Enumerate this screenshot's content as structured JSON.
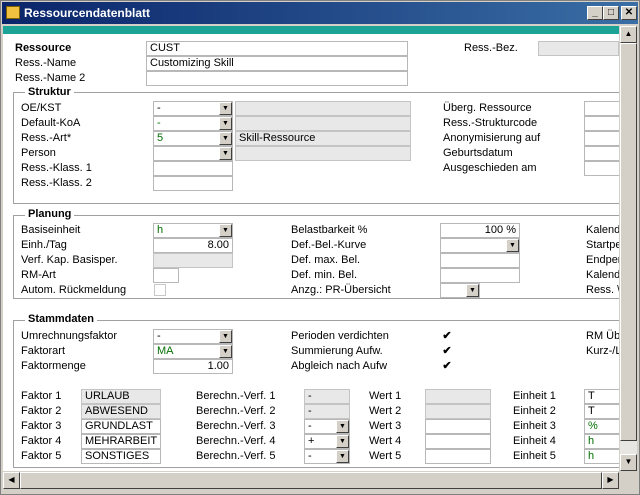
{
  "window": {
    "title": "Ressourcendatenblatt",
    "min_btn": "_",
    "max_btn": "□",
    "close_btn": "✕"
  },
  "header": {
    "ressource_label": "Ressource",
    "ressource_value": "CUST",
    "name_label": "Ress.-Name",
    "name_value": "Customizing Skill",
    "name2_label": "Ress.-Name 2",
    "name2_value": "",
    "bez_label": "Ress.-Bez.",
    "bez_value": ""
  },
  "struktur": {
    "title": "Struktur",
    "oekst_label": "OE/KST",
    "oekst_value": "-",
    "oekst_desc": "",
    "koa_label": "Default-KoA",
    "koa_value": "-",
    "koa_desc": "",
    "art_label": "Ress.-Art*",
    "art_value": "5",
    "art_desc": "Skill-Ressource",
    "person_label": "Person",
    "person_value": "",
    "person_desc": "",
    "klass1_label": "Ress.-Klass. 1",
    "klass1_value": "",
    "klass2_label": "Ress.-Klass. 2",
    "klass2_value": "",
    "uebg_label": "Überg. Ressource",
    "strukturcode_label": "Ress.-Strukturcode",
    "anonym_label": "Anonymisierung auf",
    "geburt_label": "Geburtsdatum",
    "ausgeschieden_label": "Ausgeschieden am"
  },
  "planung": {
    "title": "Planung",
    "basis_label": "Basiseinheit",
    "basis_value": "h",
    "einh_label": "Einh./Tag",
    "einh_value": "8.00",
    "verf_label": "Verf. Kap. Basisper.",
    "verf_value": "",
    "rmart_label": "RM-Art",
    "rmart_value": "",
    "autom_label": "Autom. Rückmeldung",
    "belast_label": "Belastbarkeit %",
    "belast_value": "100 %",
    "defbel_label": "Def.-Bel.-Kurve",
    "defbel_value": "",
    "defmax_label": "Def. max. Bel.",
    "defmax_value": "",
    "defmin_label": "Def. min. Bel.",
    "defmin_value": "",
    "anzg_label": "Anzg.: PR-Übersicht",
    "anzg_value": "",
    "kalend1_label": "Kalend",
    "startpe_label": "Startpe",
    "endper_label": "Endper",
    "kalend2_label": "Kalend",
    "ress_cut_label": "Ress. \\"
  },
  "stammdaten": {
    "title": "Stammdaten",
    "umr_label": "Umrechnungsfaktor",
    "umr_value": "-",
    "faktorart_label": "Faktorart",
    "faktorart_value": "MA",
    "faktormenge_label": "Faktormenge",
    "faktormenge_value": "1.00",
    "perioden_label": "Perioden verdichten",
    "perioden_check": "✔",
    "summierung_label": "Summierung Aufw.",
    "summierung_check": "✔",
    "abgleich_label": "Abgleich nach Aufw",
    "abgleich_check": "✔",
    "rmueb_label": "RM Übe",
    "kurz_label": "Kurz-/L",
    "rows": [
      {
        "faktor_label": "Faktor 1",
        "faktor_value": "URLAUB",
        "berechn_label": "Berechn.-Verf. 1",
        "berechn_value": "-",
        "wert_label": "Wert 1",
        "wert_value": "",
        "einheit_label": "Einheit 1",
        "einheit_value": "T"
      },
      {
        "faktor_label": "Faktor 2",
        "faktor_value": "ABWESEND",
        "berechn_label": "Berechn.-Verf. 2",
        "berechn_value": "-",
        "wert_label": "Wert 2",
        "wert_value": "",
        "einheit_label": "Einheit 2",
        "einheit_value": "T"
      },
      {
        "faktor_label": "Faktor 3",
        "faktor_value": "GRUNDLAST",
        "berechn_label": "Berechn.-Verf. 3",
        "berechn_value": "-",
        "wert_label": "Wert 3",
        "wert_value": "",
        "einheit_label": "Einheit 3",
        "einheit_value": "%"
      },
      {
        "faktor_label": "Faktor 4",
        "faktor_value": "MEHRARBEIT",
        "berechn_label": "Berechn.-Verf. 4",
        "berechn_value": "+",
        "wert_label": "Wert 4",
        "wert_value": "",
        "einheit_label": "Einheit 4",
        "einheit_value": "h"
      },
      {
        "faktor_label": "Faktor 5",
        "faktor_value": "SONSTIGES",
        "berechn_label": "Berechn.-Verf. 5",
        "berechn_value": "-",
        "wert_label": "Wert 5",
        "wert_value": "",
        "einheit_label": "Einheit 5",
        "einheit_value": "h"
      }
    ]
  },
  "scroll": {
    "up": "▲",
    "down": "▼",
    "left": "◀",
    "right": "▶"
  },
  "dropdown_glyph": "▼"
}
